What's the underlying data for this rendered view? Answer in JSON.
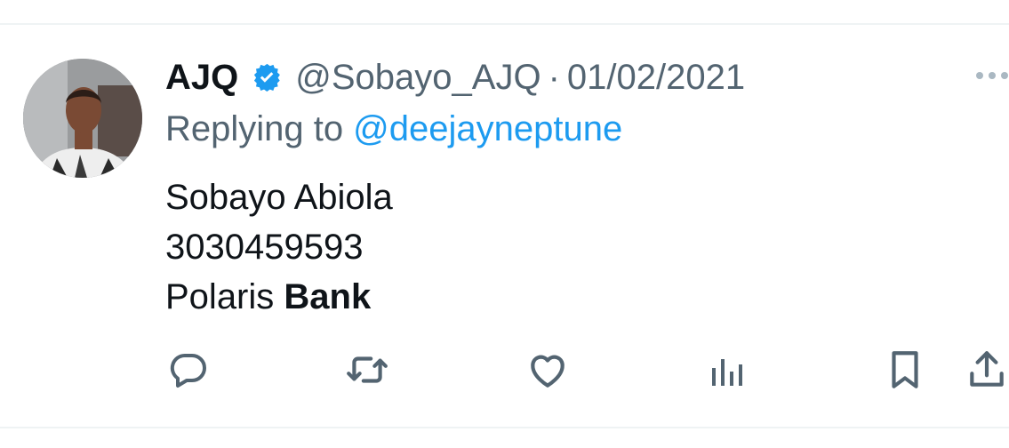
{
  "tweet": {
    "display_name": "AJQ",
    "handle": "@Sobayo_AJQ",
    "separator": "·",
    "date": "01/02/2021",
    "reply_prefix": "Replying to",
    "reply_mention": "@deejayneptune",
    "body_lines": [
      "Sobayo Abiola",
      "3030459593",
      "Polaris "
    ],
    "body_bold": "Bank"
  },
  "icons": {
    "verified": "verified-badge-icon",
    "more": "more-options-icon",
    "reply": "reply-icon",
    "retweet": "retweet-icon",
    "like": "like-icon",
    "views": "views-icon",
    "bookmark": "bookmark-icon",
    "share": "share-icon"
  },
  "colors": {
    "text_primary": "#0f1419",
    "text_secondary": "#536471",
    "accent": "#1d9bf0",
    "divider": "#eff3f4"
  }
}
